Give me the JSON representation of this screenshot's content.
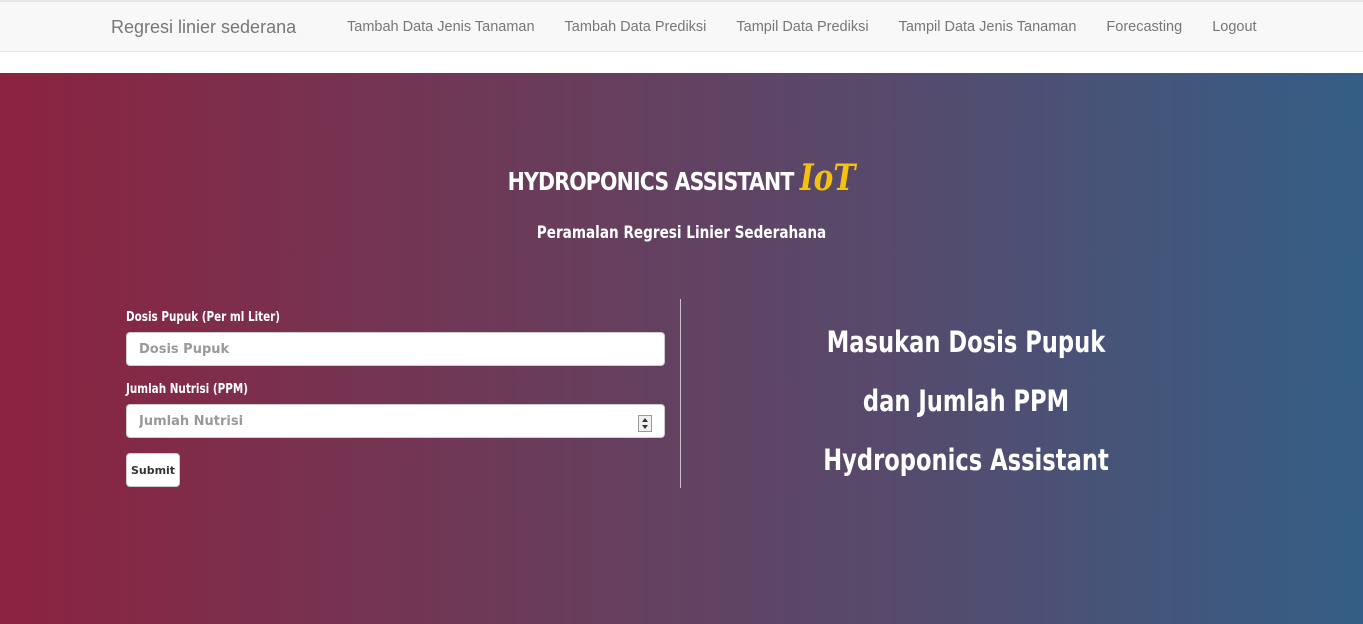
{
  "navbar": {
    "brand": "Regresi linier sederana",
    "links": [
      {
        "label": "Tambah Data Jenis Tanaman"
      },
      {
        "label": "Tambah Data Prediksi"
      },
      {
        "label": "Tampil Data Prediksi"
      },
      {
        "label": "Tampil Data Jenis Tanaman"
      },
      {
        "label": "Forecasting"
      },
      {
        "label": "Logout"
      }
    ]
  },
  "hero": {
    "title": "HYDROPONICS ASSISTANT",
    "title_accent": "IoT",
    "subtitle": "Peramalan Regresi Linier Sederahana",
    "colors": {
      "gradient_left": "#8b2340",
      "gradient_right": "#355e86",
      "accent": "#f4c20d"
    }
  },
  "form": {
    "dosis": {
      "label": "Dosis Pupuk (Per ml Liter)",
      "placeholder": "Dosis Pupuk",
      "value": ""
    },
    "nutrisi": {
      "label": "Jumlah Nutrisi (PPM)",
      "placeholder": "Jumlah Nutrisi",
      "value": ""
    },
    "submit_label": "Submit"
  },
  "info": {
    "lines": [
      "Masukan Dosis Pupuk",
      "dan Jumlah PPM",
      "Hydroponics Assistant"
    ]
  }
}
